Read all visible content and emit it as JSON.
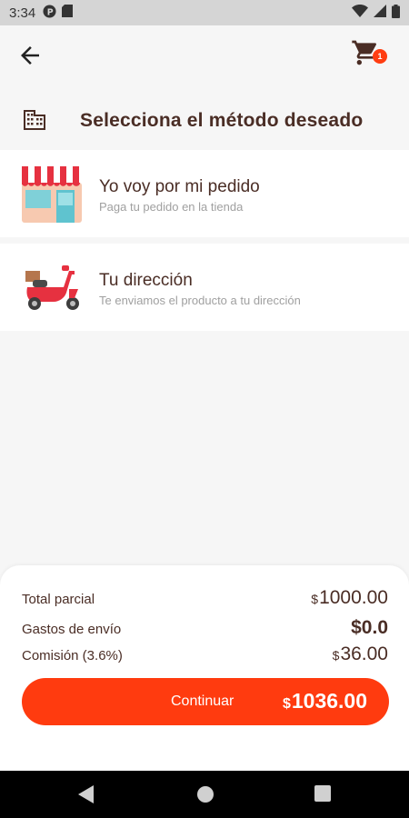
{
  "status_bar": {
    "time": "3:34",
    "icons": [
      "p-circle-icon",
      "sd-card-icon",
      "wifi-icon",
      "signal-icon",
      "battery-icon"
    ]
  },
  "app_bar": {
    "back_icon": "arrow-left-icon",
    "cart_icon": "shopping-cart-icon",
    "cart_badge": "1"
  },
  "section": {
    "icon": "building-icon",
    "title": "Selecciona el método deseado"
  },
  "delivery_options": [
    {
      "icon": "store-icon",
      "title": "Yo voy por mi pedido",
      "subtitle": "Paga tu pedido en la tienda"
    },
    {
      "icon": "scooter-icon",
      "title": "Tu dirección",
      "subtitle": "Te enviamos el producto a tu dirección"
    }
  ],
  "summary": {
    "subtotal_label": "Total parcial",
    "subtotal_currency": "$",
    "subtotal_value": "1000.00",
    "shipping_label": "Gastos de envío",
    "shipping_value": "$0.0",
    "commission_label": "Comisión (3.6%)",
    "commission_currency": "$",
    "commission_value": "36.00",
    "continue_label": "Continuar",
    "total_currency": "$",
    "total_value": "1036.00"
  },
  "colors": {
    "accent": "#ff3b0f",
    "text_primary": "#4a2d25",
    "text_secondary": "#a0a0a0",
    "background": "#f6f6f6"
  },
  "nav_bar": {
    "icons": [
      "back-triangle-icon",
      "home-circle-icon",
      "recents-square-icon"
    ]
  }
}
